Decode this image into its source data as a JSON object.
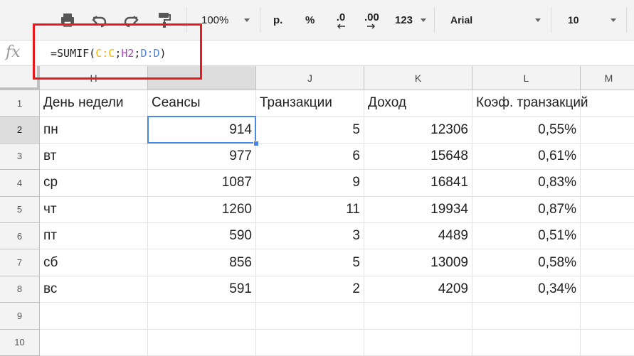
{
  "toolbar": {
    "zoom": "100%",
    "currency": "р.",
    "percent": "%",
    "dec_less": ".0",
    "dec_more": ".00",
    "format_more": "123",
    "font": "Arial",
    "font_size": "10",
    "accent": "#0f9d58"
  },
  "formula_bar": {
    "fx": "fx",
    "parts": [
      {
        "text": "=SUMIF(",
        "color": "#222222"
      },
      {
        "text": "C:C",
        "color": "#f4b400"
      },
      {
        "text": ";",
        "color": "#222222"
      },
      {
        "text": "H2",
        "color": "#ab47bc"
      },
      {
        "text": ";",
        "color": "#222222"
      },
      {
        "text": "D:D",
        "color": "#4a86e8"
      },
      {
        "text": ")",
        "color": "#222222"
      }
    ]
  },
  "columns": [
    "H",
    "",
    "J",
    "K",
    "L",
    "M"
  ],
  "row_numbers": [
    "1",
    "2",
    "3",
    "4",
    "5",
    "6",
    "7",
    "8",
    "9",
    "10"
  ],
  "rows": [
    [
      "День недели",
      "Сеансы",
      "Транзакции",
      "Доход",
      "Коэф. транзакций"
    ],
    [
      "пн",
      "914",
      "5",
      "12306",
      "0,55%"
    ],
    [
      "вт",
      "977",
      "6",
      "15648",
      "0,61%"
    ],
    [
      "ср",
      "1087",
      "9",
      "16841",
      "0,83%"
    ],
    [
      "чт",
      "1260",
      "11",
      "19934",
      "0,87%"
    ],
    [
      "пт",
      "590",
      "3",
      "4489",
      "0,51%"
    ],
    [
      "сб",
      "856",
      "5",
      "13009",
      "0,58%"
    ],
    [
      "вс",
      "591",
      "2",
      "4209",
      "0,34%"
    ],
    [
      "",
      "",
      "",
      "",
      ""
    ],
    [
      "",
      "",
      "",
      "",
      ""
    ]
  ],
  "active_cell": "I2",
  "highlight_color": "#ea1a1a"
}
